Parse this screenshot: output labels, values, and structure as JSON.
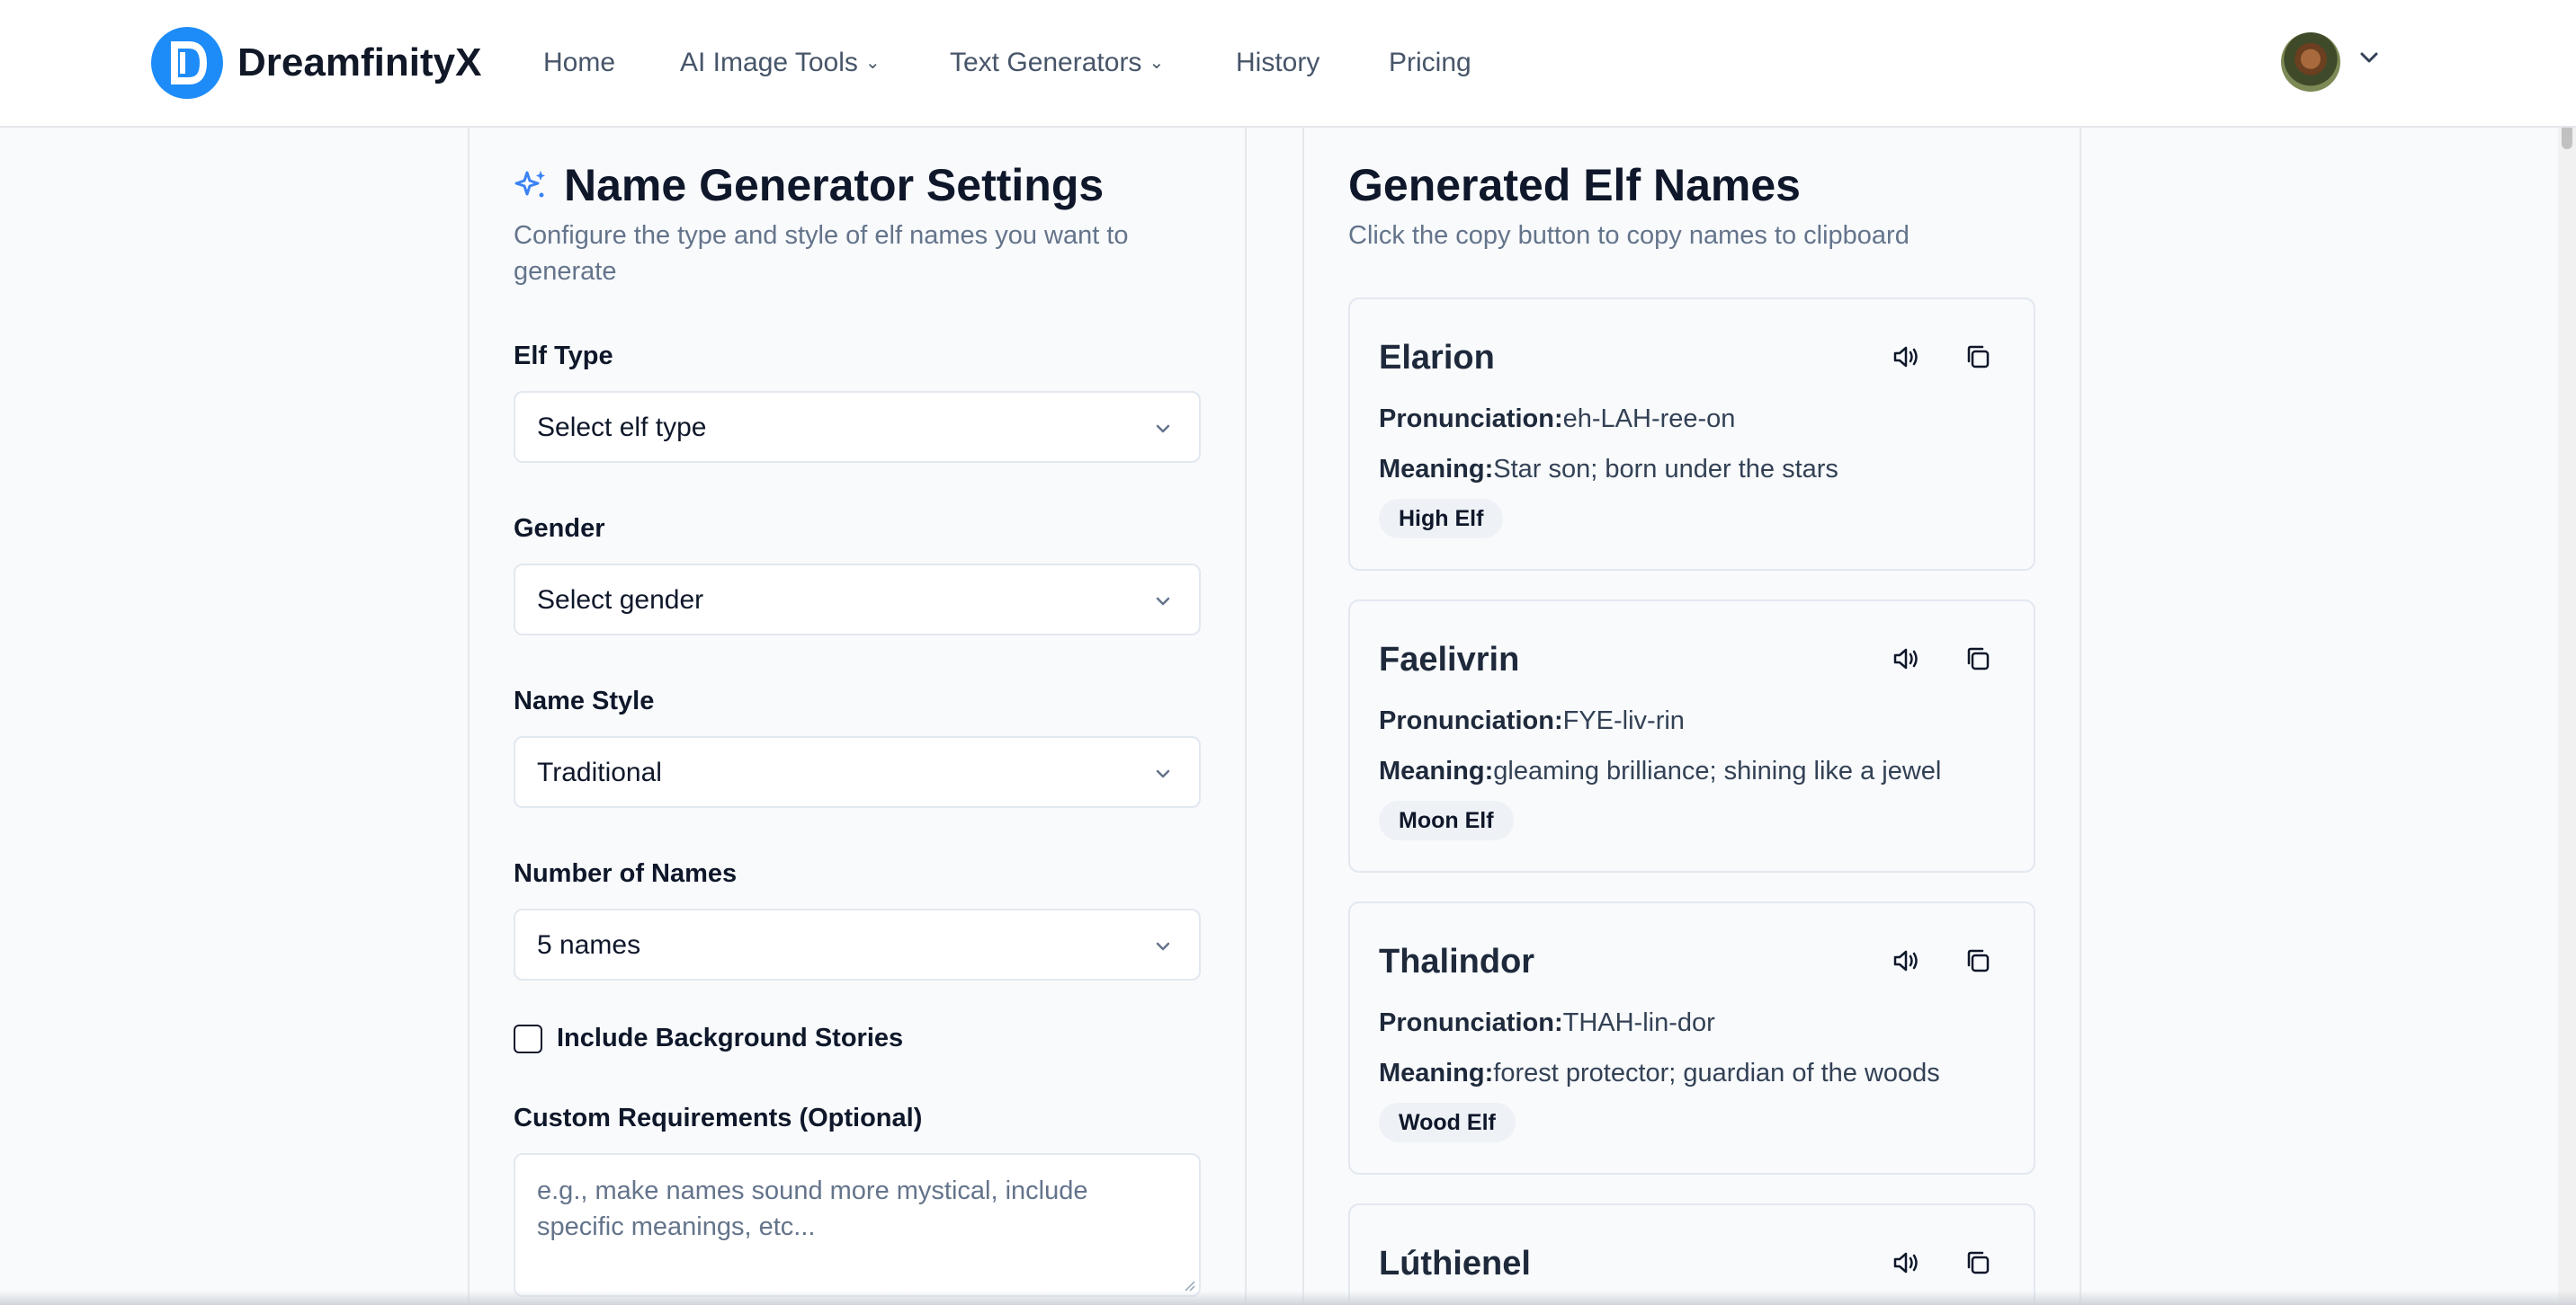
{
  "header": {
    "brand": "DreamfinityX",
    "nav": [
      {
        "label": "Home"
      },
      {
        "label": "AI Image Tools"
      },
      {
        "label": "Text Generators"
      },
      {
        "label": "History"
      },
      {
        "label": "Pricing"
      }
    ]
  },
  "settings": {
    "title": "Name Generator Settings",
    "description": "Configure the type and style of elf names you want to generate",
    "fields": [
      {
        "label": "Elf Type",
        "value": "Select elf type"
      },
      {
        "label": "Gender",
        "value": "Select gender"
      },
      {
        "label": "Name Style",
        "value": "Traditional"
      },
      {
        "label": "Number of Names",
        "value": "5 names"
      }
    ],
    "checkbox_label": "Include Background Stories",
    "custom_label": "Custom Requirements (Optional)",
    "custom_placeholder": "e.g., make names sound more mystical, include specific meanings, etc..."
  },
  "results": {
    "title": "Generated Elf Names",
    "description": "Click the copy button to copy names to clipboard",
    "pronunciation_key": "Pronunciation:",
    "meaning_key": "Meaning:",
    "names": [
      {
        "name": "Elarion",
        "pronunciation": "eh-LAH-ree-on",
        "meaning": "Star son; born under the stars",
        "badge": "High Elf"
      },
      {
        "name": "Faelivrin",
        "pronunciation": "FYE-liv-rin",
        "meaning": "gleaming brilliance; shining like a jewel",
        "badge": "Moon Elf"
      },
      {
        "name": "Thalindor",
        "pronunciation": "THAH-lin-dor",
        "meaning": "forest protector; guardian of the woods",
        "badge": "Wood Elf"
      },
      {
        "name": "Lúthienel"
      }
    ]
  },
  "colors": {
    "accent": "#1d8cf8",
    "text": "#0f172a",
    "muted": "#64748b"
  }
}
